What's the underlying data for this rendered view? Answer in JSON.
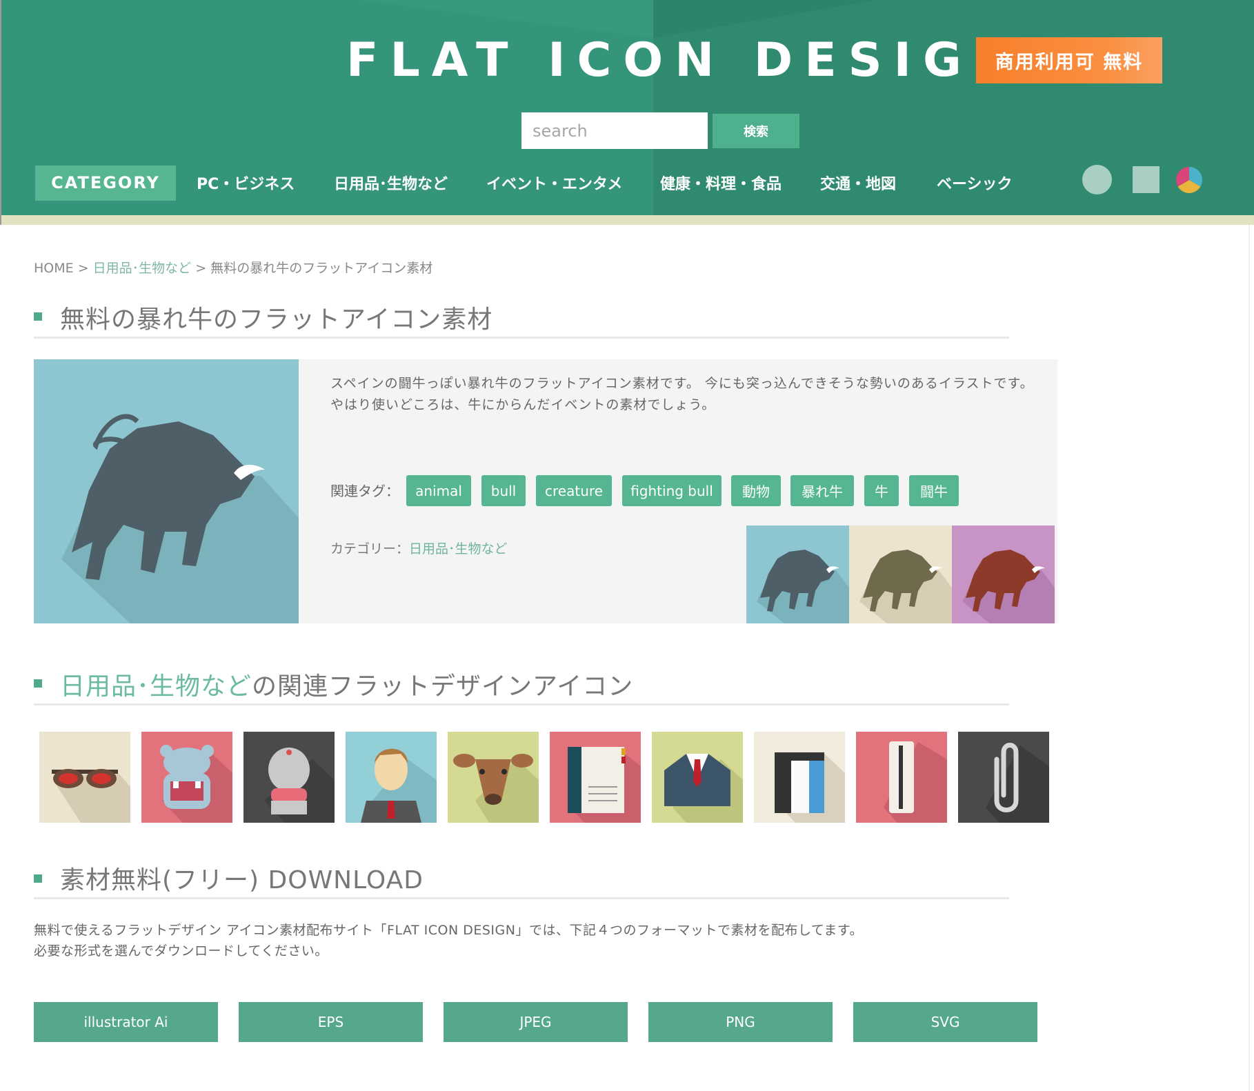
{
  "header": {
    "site_title": "FLAT ICON DESIGN",
    "badge": "商用利用可 無料",
    "search_placeholder": "search",
    "search_button": "検索"
  },
  "nav": {
    "category_label": "CATEGORY",
    "items": [
      "PC・ビジネス",
      "日用品･生物など",
      "イベント・エンタメ",
      "健康・料理・食品",
      "交通・地図",
      "ベーシック"
    ],
    "shape_icons": [
      "circle-icon",
      "square-icon",
      "color-wheel-icon"
    ]
  },
  "breadcrumb": {
    "home": "HOME",
    "sep": ">",
    "category": "日用品･生物など",
    "current": "無料の暴れ牛のフラットアイコン素材"
  },
  "main": {
    "title": "無料の暴れ牛のフラットアイコン素材",
    "description_1": "スペインの闘牛っぽい暴れ牛のフラットアイコン素材です。 今にも突っ込んできそうな勢いのあるイラストです。",
    "description_2": "やはり使いどころは、牛にからんだイベントの素材でしょう。",
    "tags_label": "関連タグ：",
    "tags": [
      "animal",
      "bull",
      "creature",
      "fighting bull",
      "動物",
      "暴れ牛",
      "牛",
      "闘牛"
    ],
    "category_label": "カテゴリー：",
    "category_value": "日用品･生物など",
    "main_icon": "bull-icon",
    "variants": [
      {
        "icon": "bull-icon",
        "bg": "#8dc5d0",
        "body": "#4f5f67"
      },
      {
        "icon": "bull-icon",
        "bg": "#ece4cf",
        "body": "#6f6a4c"
      },
      {
        "icon": "bull-icon",
        "bg": "#c894c6",
        "body": "#8e3a2a"
      }
    ]
  },
  "related": {
    "title_accent": "日用品･生物など",
    "title_rest": "の関連フラットデザインアイコン",
    "icons": [
      {
        "icon": "glasses-icon",
        "bg": "#ece4cf"
      },
      {
        "icon": "hippo-icon",
        "bg": "#e2737d"
      },
      {
        "icon": "buddha-statue-icon",
        "bg": "#4a4a4a"
      },
      {
        "icon": "businessman-icon",
        "bg": "#93cfd6"
      },
      {
        "icon": "deer-icon",
        "bg": "#d5da92"
      },
      {
        "icon": "notebook-icon",
        "bg": "#e2737d"
      },
      {
        "icon": "suit-icon",
        "bg": "#d5da92"
      },
      {
        "icon": "eraser-icon",
        "bg": "#f0ebdc"
      },
      {
        "icon": "ruler-icon",
        "bg": "#e2737d"
      },
      {
        "icon": "paperclip-icon",
        "bg": "#4a4a4a"
      }
    ]
  },
  "download": {
    "title": "素材無料(フリー) DOWNLOAD",
    "text_1": "無料で使えるフラットデザイン アイコン素材配布サイト「FLAT ICON DESIGN」では、下記４つのフォーマットで素材を配布してます。",
    "text_2": "必要な形式を選んでダウンロードしてください。",
    "buttons": [
      "illustrator Ai",
      "EPS",
      "JPEG",
      "PNG",
      "SVG"
    ]
  },
  "colors": {
    "brand_green": "#35957a",
    "accent_green": "#55b691",
    "badge_orange": "#f77f2c"
  }
}
